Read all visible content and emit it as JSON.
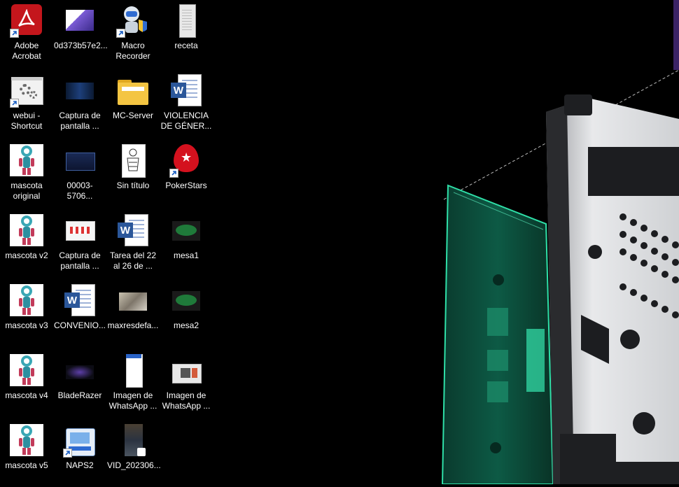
{
  "desktop": {
    "icons": [
      {
        "label": "Adobe\nAcrobat",
        "type": "acrobat",
        "shortcut": true
      },
      {
        "label": "0d373b57e2...",
        "type": "img-purple",
        "shortcut": false
      },
      {
        "label": "Macro\nRecorder",
        "type": "macro-robot",
        "shortcut": true
      },
      {
        "label": "receta",
        "type": "doc-scan",
        "shortcut": false
      },
      {
        "label": "webui -\nShortcut",
        "type": "settings-window",
        "shortcut": true
      },
      {
        "label": "Captura de\npantalla ...",
        "type": "img-dark-blue",
        "shortcut": false
      },
      {
        "label": "MC-Server",
        "type": "folder",
        "shortcut": false
      },
      {
        "label": "VIOLENCIA\nDE GÉNER...",
        "type": "word",
        "shortcut": false
      },
      {
        "label": "mascota\noriginal",
        "type": "mascot",
        "shortcut": false
      },
      {
        "label": "00003-5706...",
        "type": "img-dark-blue2",
        "shortcut": false
      },
      {
        "label": "Sin título",
        "type": "drawing",
        "shortcut": false
      },
      {
        "label": "PokerStars",
        "type": "pokerstars",
        "shortcut": true
      },
      {
        "label": "mascota v2",
        "type": "mascot",
        "shortcut": false
      },
      {
        "label": "Captura de\npantalla ...",
        "type": "img-white-page",
        "shortcut": false
      },
      {
        "label": "Tarea del 22\nal 26 de ...",
        "type": "word",
        "shortcut": false
      },
      {
        "label": "mesa1",
        "type": "poker-table",
        "shortcut": false
      },
      {
        "label": "mascota v3",
        "type": "mascot",
        "shortcut": false
      },
      {
        "label": "CONVENIO...",
        "type": "word",
        "shortcut": false
      },
      {
        "label": "maxresdefa...",
        "type": "img-photo",
        "shortcut": false
      },
      {
        "label": "mesa2",
        "type": "poker-table",
        "shortcut": false
      },
      {
        "label": "mascota v4",
        "type": "mascot",
        "shortcut": false
      },
      {
        "label": "BladeRazer",
        "type": "img-razer",
        "shortcut": false
      },
      {
        "label": "Imagen de\nWhatsApp ...",
        "type": "img-phone",
        "shortcut": false
      },
      {
        "label": "Imagen de\nWhatsApp ...",
        "type": "img-screen",
        "shortcut": false
      },
      {
        "label": "mascota v5",
        "type": "mascot",
        "shortcut": false
      },
      {
        "label": "NAPS2",
        "type": "scanner",
        "shortcut": true
      },
      {
        "label": "VID_202306...",
        "type": "video",
        "shortcut": false
      }
    ]
  },
  "colors": {
    "background": "#000000",
    "circuit_green": "#2fe0a8",
    "metal_gray": "#d9dadc",
    "purple_edge": "#4a2a7a",
    "acrobat_red": "#c4161c",
    "word_blue": "#2b579a",
    "folder_yellow": "#f4c542",
    "pokerstars_red": "#d4111e"
  }
}
